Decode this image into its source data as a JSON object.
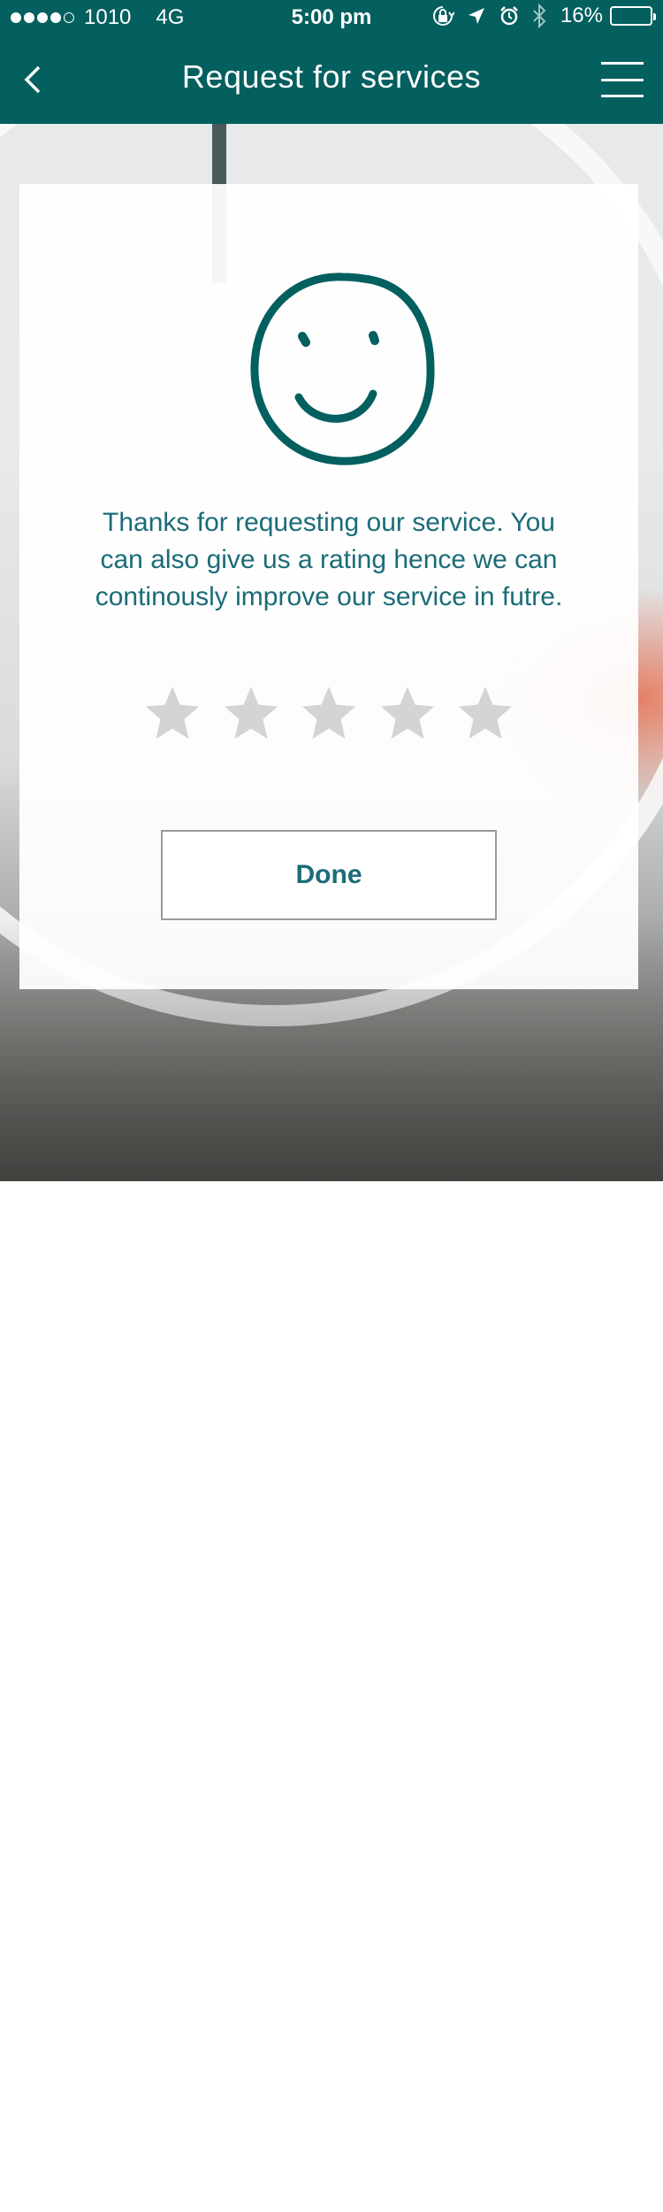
{
  "status_bar": {
    "carrier": "1010",
    "network": "4G",
    "time": "5:00 pm",
    "battery_percent": "16%",
    "battery_level": 0.16,
    "signal_bars_filled": 4,
    "signal_bars_total": 5,
    "icons": [
      "rotation-lock-icon",
      "location-arrow-icon",
      "alarm-icon",
      "bluetooth-icon",
      "battery-icon"
    ]
  },
  "nav": {
    "title": "Request for services",
    "back_icon": "chevron-left-icon",
    "menu_icon": "hamburger-menu-icon"
  },
  "card": {
    "icon": "smiley-face-icon",
    "message": "Thanks for  requesting our service. You can also give us a rating hence we can continously improve our service in futre.",
    "rating": {
      "max": 5,
      "value": 0
    },
    "done_label": "Done"
  },
  "colors": {
    "header_bg": "#045f5f",
    "accent_text": "#1a6c78",
    "smiley_stroke": "#045f5f",
    "star_inactive": "#d4d4d4",
    "battery_low": "#e23a2e"
  }
}
